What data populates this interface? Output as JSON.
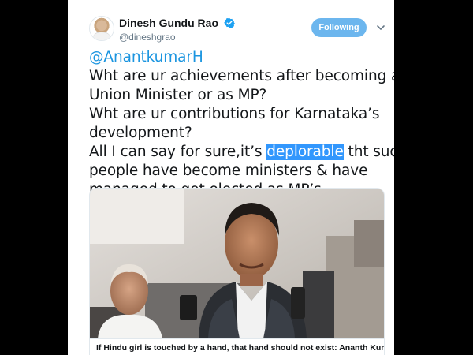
{
  "user": {
    "display_name": "Dinesh Gundu Rao",
    "handle": "@dineshgrao",
    "verified_icon": "verified-badge-icon",
    "avatar_icon": "profile-photo"
  },
  "header": {
    "follow_label": "Following",
    "menu_icon": "chevron-down-icon"
  },
  "tweet": {
    "mention": "@AnantkumarH",
    "line1": "Wht are ur achievements after becoming a",
    "line2": "Union Minister or as MP?",
    "line3": "Wht are ur contributions for Karnataka’s",
    "line4": "development?",
    "line5_pre": "All I can say for sure,it’s ",
    "line5_highlight": "deplorable",
    "line5_post": " tht such",
    "line6": "people have become ministers & have",
    "line7": "managed to get elected as MP’s."
  },
  "media": {
    "caption": "If Hindu girl is touched by a hand, that hand should not exist: Ananth Kumar ..."
  },
  "colors": {
    "accent": "#1b95e0",
    "follow_button": "#6cb6ee",
    "selection": "#3297fd",
    "background": "#000000"
  }
}
